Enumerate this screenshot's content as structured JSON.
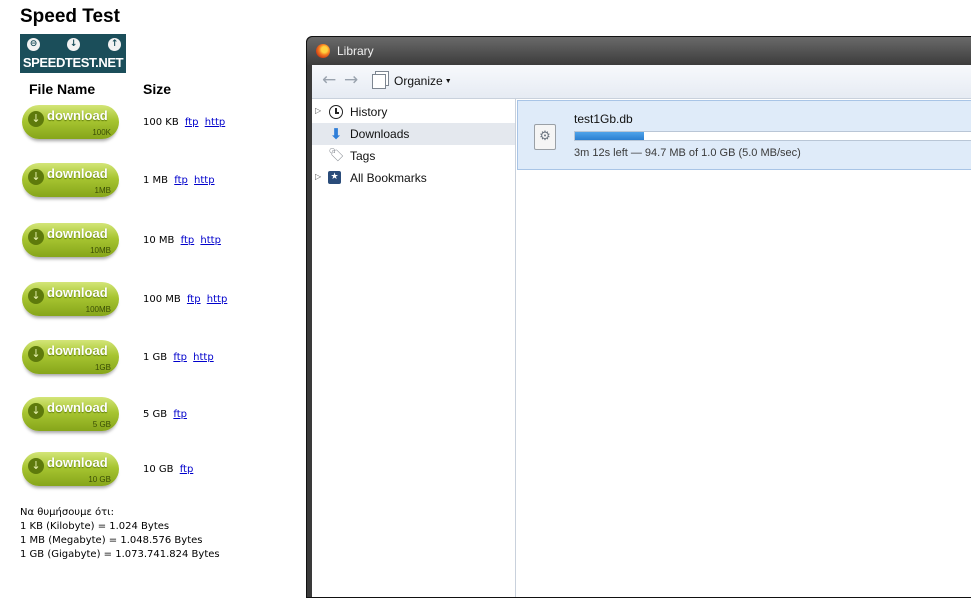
{
  "page": {
    "title": "Speed Test",
    "logo_text": "SPEEDTEST.NET",
    "col_file": "File Name",
    "col_size": "Size",
    "download_word": "download",
    "files": [
      {
        "badge": "100K",
        "size": "100 KB",
        "ftp": "ftp",
        "http": "http"
      },
      {
        "badge": "1MB",
        "size": "1 MB",
        "ftp": "ftp",
        "http": "http"
      },
      {
        "badge": "10MB",
        "size": "10 MB",
        "ftp": "ftp",
        "http": "http"
      },
      {
        "badge": "100MB",
        "size": "100 MB",
        "ftp": "ftp",
        "http": "http"
      },
      {
        "badge": "1GB",
        "size": "1 GB",
        "ftp": "ftp",
        "http": "http"
      },
      {
        "badge": "5 GB",
        "size": "5 GB",
        "ftp": "ftp"
      },
      {
        "badge": "10 GB",
        "size": "10 GB",
        "ftp": "ftp"
      }
    ],
    "note_lines": [
      "Να θυμήσουμε ότι:",
      "1 KB (Kilobyte) = 1.024 Bytes",
      "1 MB (Megabyte) = 1.048.576 Bytes",
      "1 GB (Gigabyte) = 1.073.741.824 Bytes"
    ]
  },
  "library": {
    "title": "Library",
    "organize_label": "Organize",
    "sidebar": [
      {
        "label": "History",
        "icon": "history-icon",
        "twisty": true
      },
      {
        "label": "Downloads",
        "icon": "downloads-icon",
        "twisty": false,
        "selected": true
      },
      {
        "label": "Tags",
        "icon": "tag-icon",
        "twisty": false
      },
      {
        "label": "All Bookmarks",
        "icon": "bookmarks-icon",
        "twisty": true
      }
    ],
    "download": {
      "filename": "test1Gb.db",
      "status": "3m 12s left — 94.7 MB of 1.0 GB (5.0 MB/sec)",
      "progress_fraction": 0.17
    }
  },
  "colors": {
    "download_green": "#a7c531",
    "logo_bg": "#1b4e5a",
    "link_blue": "#0000cc",
    "download_row_bg": "#dfebf9",
    "progress_blue": "#2b7fd0"
  }
}
